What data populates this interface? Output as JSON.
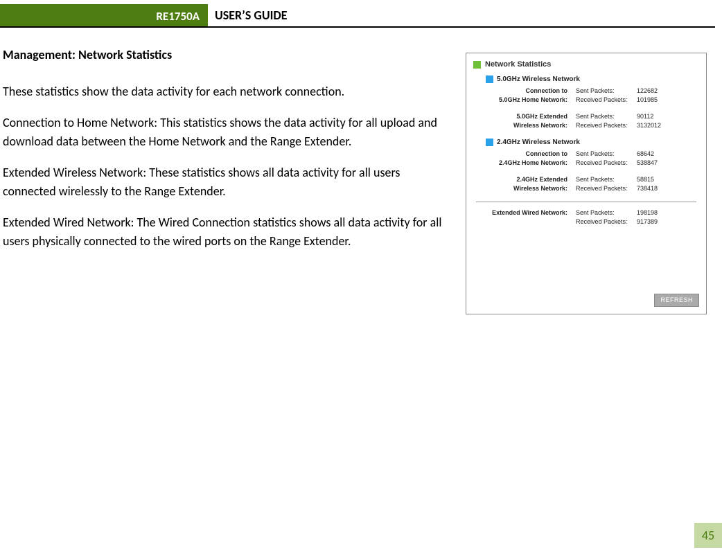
{
  "header": {
    "model": "RE1750A",
    "guide": "USER’S GUIDE"
  },
  "page": {
    "heading": "Management: Network Statistics",
    "p1": "These statistics show the data activity for each network connection.",
    "p2": "Connection to Home Network: This statistics shows the data activity for all upload and download data between the Home Network and the Range Extender.",
    "p3": "Extended Wireless Network: These statistics shows all data activity for all users connected wirelessly to the Range Extender.",
    "p4": "Extended Wired Network: The Wired Connection statistics shows all data activity for all users physically connected to the wired ports on the Range Extender.",
    "number": "45"
  },
  "panel": {
    "title": "Network Statistics",
    "section5": "5.0GHz Wireless Network",
    "section24": "2.4GHz Wireless Network",
    "labels": {
      "sent": "Sent Packets:",
      "recv": "Received Packets:"
    },
    "conn5_1": "Connection to",
    "conn5_2": "5.0GHz Home Network:",
    "ext5_1": "5.0GHz Extended",
    "ext5_2": "Wireless Network:",
    "conn24_1": "Connection to",
    "conn24_2": "2.4GHz Home Network:",
    "ext24_1": "2.4GHz Extended",
    "ext24_2": "Wireless Network:",
    "wired": "Extended Wired Network:",
    "stats": {
      "home5_sent": "122682",
      "home5_recv": "101985",
      "ext5_sent": "90112",
      "ext5_recv": "3132012",
      "home24_sent": "68642",
      "home24_recv": "538847",
      "ext24_sent": "58815",
      "ext24_recv": "738418",
      "wired_sent": "198198",
      "wired_recv": "917389"
    },
    "refresh": "REFRESH"
  }
}
